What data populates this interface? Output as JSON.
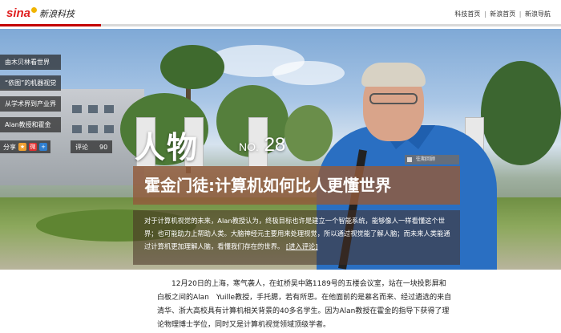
{
  "header": {
    "logo_brand": "sina",
    "logo_text": "新浪科技",
    "nav": [
      "科技首页",
      "新浪首页",
      "新浪导航"
    ],
    "nav_separator": "|"
  },
  "sidebar": {
    "items": [
      {
        "label": "由木贝林看世界"
      },
      {
        "label": "“依图”的机器视觉"
      },
      {
        "label": "从学术界到产业界"
      },
      {
        "label": "Alan教授和霍金"
      }
    ],
    "share_label": "分享",
    "share_icons": [
      "qzone-icon",
      "weibo-icon",
      "plus-icon"
    ],
    "comment_label": "评论",
    "comment_count": "90"
  },
  "hero": {
    "person_label": "人物",
    "issue_prefix": "NO.",
    "issue_number": "28",
    "badge": "往期回顾",
    "title": "霍金门徒:计算机如何比人更懂世界",
    "description": "对于计算机视觉的未来，Alan教授认为，终极目标也许是建立一个智能系统，能够像人一样看懂这个世界；也可能助力上帮助人类。大脑神经元主要用来处理视觉，所以通过视觉能了解人脑；而未来人类能通过计算机更加理解人脑，看懂我们存在的世界。",
    "desc_link": "[进入评论]"
  },
  "article": {
    "paragraph": "12月20日的上海，寒气袭人，在虹桥吴中路1189号的五楼会议室，站在一块投影屏和白板之间的Alan　Yuille教授，手托腮，若有所思。在他面前的是慕名而来、经过遴选的来自清华、浙大高校具有计算机相关背景的40多名学生。因为Alan教授在霍金的指导下获得了理论物理博士学位，同时又是计算机视觉领域顶级学者。"
  },
  "colors": {
    "brand_red": "#e02020",
    "title_panel": "#925a3a",
    "shirt_blue": "#2a6fc2"
  }
}
